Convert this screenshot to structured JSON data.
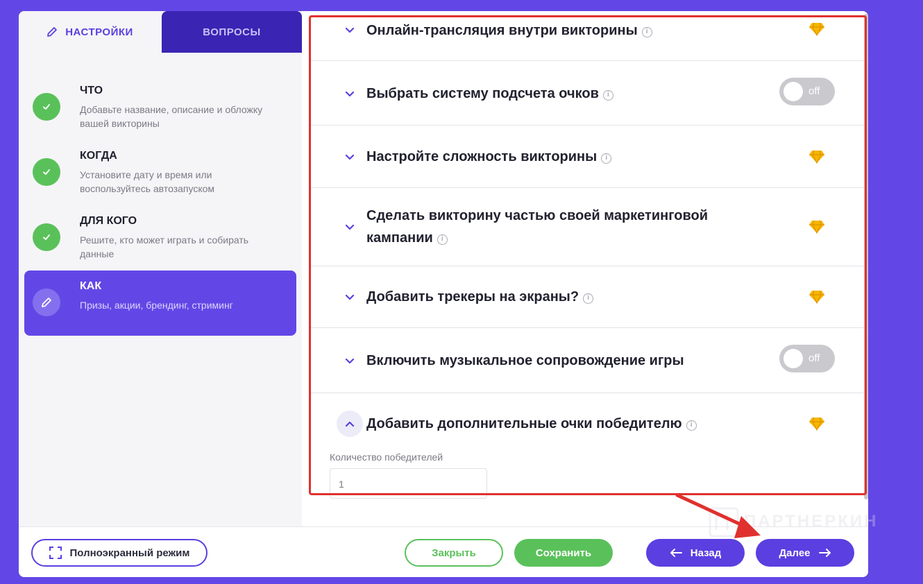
{
  "tabs": {
    "settings": "НАСТРОЙКИ",
    "questions": "ВОПРОСЫ"
  },
  "steps": [
    {
      "title": "ЧТО",
      "desc": "Добавьте название, описание и обложку вашей викторины",
      "status": "done"
    },
    {
      "title": "КОГДА",
      "desc": "Установите дату и время или воспользуйтесь автозапуском",
      "status": "done"
    },
    {
      "title": "ДЛЯ КОГО",
      "desc": "Решите, кто может играть и собирать данные",
      "status": "done"
    },
    {
      "title": "КАК",
      "desc": "Призы, акции, брендинг, стриминг",
      "status": "active"
    }
  ],
  "settings_rows": [
    {
      "label": "Онлайн-трансляция внутри викторины",
      "control": "premium"
    },
    {
      "label": "Выбрать систему подсчета очков",
      "control": "toggle",
      "toggle": "off"
    },
    {
      "label": "Настройте сложность викторины",
      "control": "premium"
    },
    {
      "label": "Сделать викторину частью своей маркетинговой кампании",
      "control": "premium"
    },
    {
      "label": "Добавить трекеры на экраны?",
      "control": "premium"
    },
    {
      "label": "Включить музыкальное сопровождение игры",
      "control": "toggle",
      "toggle": "off"
    },
    {
      "label": "Добавить дополнительные очки победителю",
      "control": "premium",
      "expanded": true
    }
  ],
  "winners": {
    "label": "Количество победителей",
    "value": "1"
  },
  "footer": {
    "fullscreen": "Полноэкранный режим",
    "close": "Закрыть",
    "save": "Сохранить",
    "back": "Назад",
    "next": "Далее"
  },
  "watermark": "ПАРТНЕРКИН",
  "colors": {
    "accent": "#5b3fe0",
    "success": "#5ac15a",
    "premium_gem": "#f5b700",
    "highlight": "#e0312e"
  }
}
